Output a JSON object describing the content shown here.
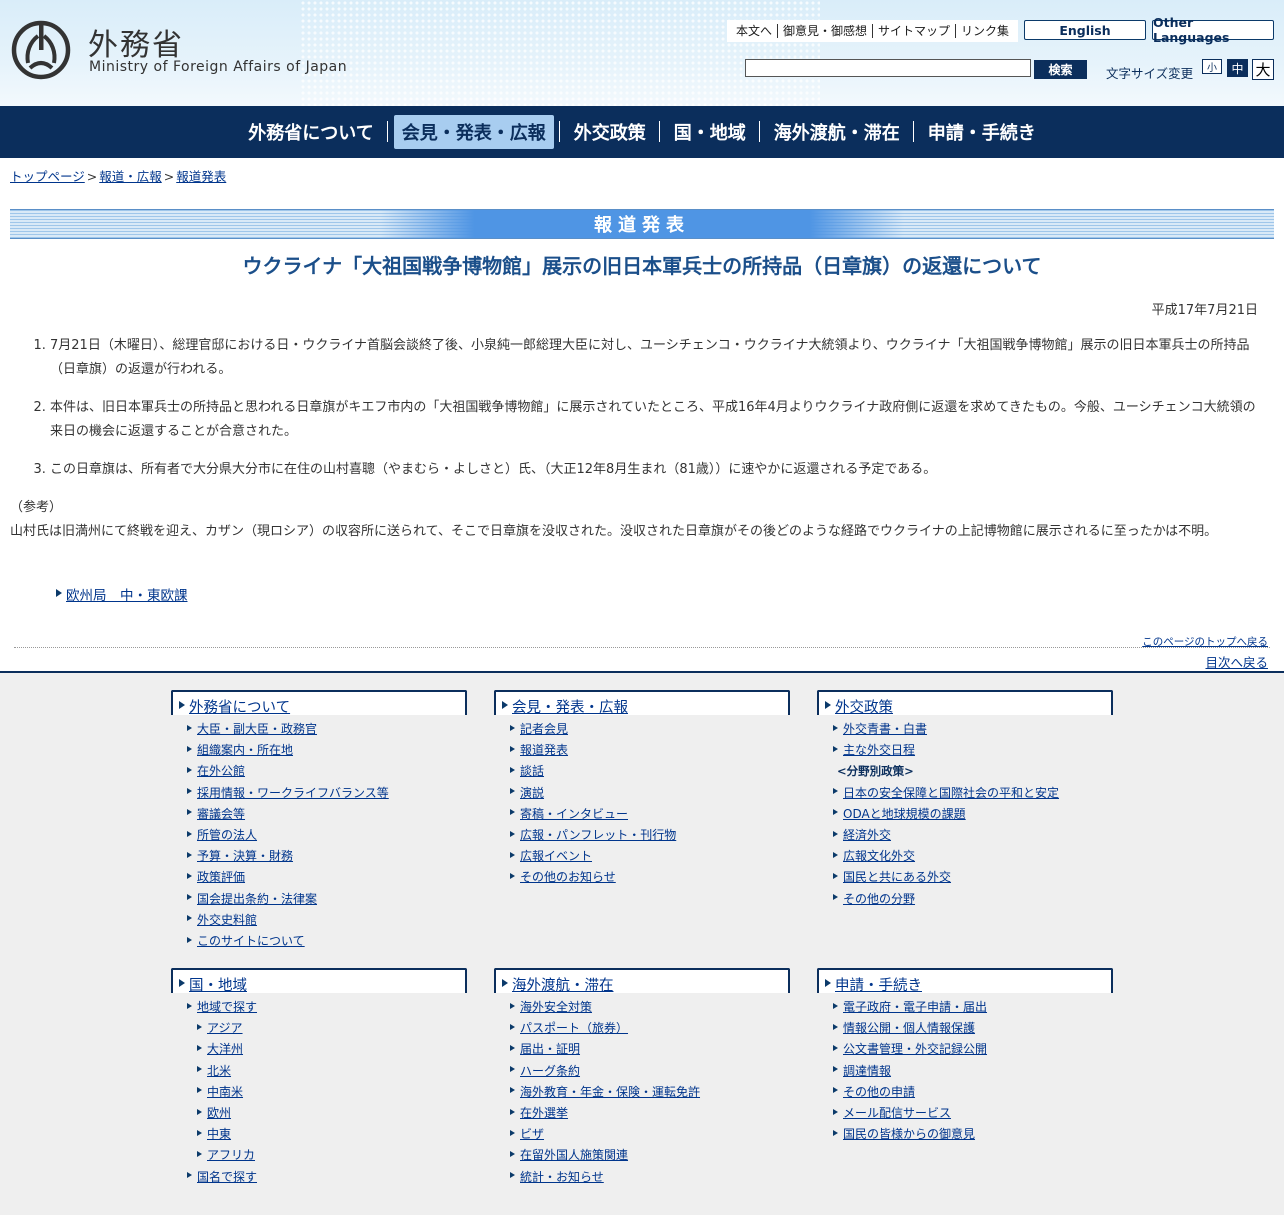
{
  "header": {
    "logo_jp": "外務省",
    "logo_en": "Ministry of Foreign Affairs of Japan",
    "util_links": [
      "本文へ",
      "御意見・御感想",
      "サイトマップ",
      "リンク集"
    ],
    "english": "English",
    "other_languages": "Other Languages",
    "search_placeholder": "",
    "search_button": "検索",
    "font_size_label": "文字サイズ変更",
    "font_small": "小",
    "font_mid": "中",
    "font_large": "大"
  },
  "gnav": [
    "外務省について",
    "会見・発表・広報",
    "外交政策",
    "国・地域",
    "海外渡航・滞在",
    "申請・手続き"
  ],
  "breadcrumb": [
    "トップページ",
    "報道・広報",
    "報道発表"
  ],
  "banner": "報道発表",
  "article": {
    "title": "ウクライナ「大祖国戦争博物館」展示の旧日本軍兵士の所持品（日章旗）の返還について",
    "date": "平成17年7月21日",
    "items": [
      "7月21日（木曜日）、総理官邸における日・ウクライナ首脳会談終了後、小泉純一郎総理大臣に対し、ユーシチェンコ・ウクライナ大統領より、ウクライナ「大祖国戦争博物館」展示の旧日本軍兵士の所持品（日章旗）の返還が行われる。",
      "本件は、旧日本軍兵士の所持品と思われる日章旗がキエフ市内の「大祖国戦争博物館」に展示されていたところ、平成16年4月よりウクライナ政府側に返還を求めてきたもの。今般、ユーシチェンコ大統領の来日の機会に返還することが合意された。",
      "この日章旗は、所有者で大分県大分市に在住の山村喜聰（やまむら・よしさと）氏、（大正12年8月生まれ（81歳））に速やかに返還される予定である。"
    ],
    "note_label": "（参考）",
    "note_text": "山村氏は旧満州にて終戦を迎え、カザン（現ロシア）の収容所に送られて、そこで日章旗を没収された。没収された日章旗がその後どのような経路でウクライナの上記博物館に展示されるに至ったかは不明。",
    "related_link": "欧州局　中・東欧課"
  },
  "page_nav": {
    "to_top": "このページのトップへ戻る",
    "to_toc": "目次へ戻る"
  },
  "footer": {
    "about": {
      "title": "外務省について",
      "items": [
        "大臣・副大臣・政務官",
        "組織案内・所在地",
        "在外公館",
        "採用情報・ワークライフバランス等",
        "審議会等",
        "所管の法人",
        "予算・決算・財務",
        "政策評価",
        "国会提出条約・法律案",
        "外交史料館",
        "このサイトについて"
      ]
    },
    "press": {
      "title": "会見・発表・広報",
      "items": [
        "記者会見",
        "報道発表",
        "談話",
        "演説",
        "寄稿・インタビュー",
        "広報・パンフレット・刊行物",
        "広報イベント",
        "その他のお知らせ"
      ]
    },
    "policy": {
      "title": "外交政策",
      "items": [
        "外交青書・白書",
        "主な外交日程"
      ],
      "label": "<分野別政策>",
      "items2": [
        "日本の安全保障と国際社会の平和と安定",
        "ODAと地球規模の課題",
        "経済外交",
        "広報文化外交",
        "国民と共にある外交",
        "その他の分野"
      ]
    },
    "region": {
      "title": "国・地域",
      "items": [
        "地域で探す",
        "アジア",
        "大洋州",
        "北米",
        "中南米",
        "欧州",
        "中東",
        "アフリカ",
        "国名で探す"
      ]
    },
    "travel": {
      "title": "海外渡航・滞在",
      "items": [
        "海外安全対策",
        "パスポート（旅券）",
        "届出・証明",
        "ハーグ条約",
        "海外教育・年金・保険・運転免許",
        "在外選挙",
        "ビザ",
        "在留外国人施策関連",
        "統計・お知らせ"
      ]
    },
    "apply": {
      "title": "申請・手続き",
      "items": [
        "電子政府・電子申請・届出",
        "情報公開・個人情報保護",
        "公文書管理・外交記録公開",
        "調達情報",
        "その他の申請",
        "メール配信サービス",
        "国民の皆様からの御意見"
      ]
    }
  }
}
